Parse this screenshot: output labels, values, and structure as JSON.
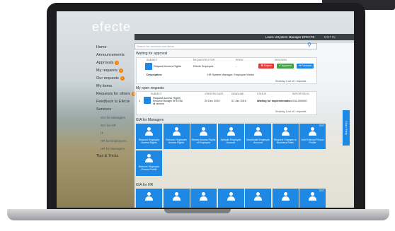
{
  "app": {
    "logo": "efecte"
  },
  "topbar": {
    "user": "Learn: eSystem Manager EFECTE",
    "context": "EXIT IN"
  },
  "nav": {
    "items": [
      {
        "label": "Home",
        "sub": false
      },
      {
        "label": "Announcements",
        "sub": false
      },
      {
        "label": "Approvals",
        "badge": "1",
        "sub": false
      },
      {
        "label": "My requests",
        "badge": "1",
        "sub": false
      },
      {
        "label": "Our requests",
        "badge": "1",
        "sub": false
      },
      {
        "label": "My items",
        "sub": false
      },
      {
        "label": "Requests for others",
        "badge": "1",
        "sub": false
      },
      {
        "label": "Feedback to Efecte",
        "sub": false
      },
      {
        "label": "Services",
        "sub": false
      },
      {
        "label": "IGA for Managers",
        "sub": true
      },
      {
        "label": "IGA for HR",
        "sub": true
      },
      {
        "label": "IT",
        "sub": true
      },
      {
        "label": "HR for Employees",
        "sub": true
      },
      {
        "label": "HR for Managers",
        "sub": true
      },
      {
        "label": "Tips & Tricks",
        "sub": false
      }
    ]
  },
  "search": {
    "placeholder": "Search for services and items..."
  },
  "approvals": {
    "title": "Waiting for approval",
    "headers": [
      "SUBJECT",
      "REQUESTED FOR",
      "PRICE",
      "DECISION"
    ],
    "row": {
      "subject": "Request Access Rights",
      "requested_for": "Efecte Employee",
      "price": "-",
      "description_label": "Description:",
      "description": "HR System Manager: Employee Works"
    },
    "buttons": {
      "reject": "✖ Reject",
      "approve": "✔ Approve",
      "forward": "➜ Forward"
    },
    "showing": "Showing 1 out of 1 requests"
  },
  "open_requests": {
    "title": "My open requests",
    "headers": [
      "SUBJECT",
      "CREATED DATE",
      "DEADLINE",
      "STATUS",
      "REPORTED ID"
    ],
    "row": {
      "num": "1",
      "subject": "Request Access Rights",
      "subject2": "Resource Manager INTEGRA",
      "subject3": "all versions",
      "created": "20 Dec 2019",
      "deadline": "01 Jan 2019",
      "status": "Waiting for implementation",
      "id": "IGA-000000"
    },
    "showing": "Showing 1 out of 1 requests"
  },
  "iga_managers": {
    "title": "IGA for Managers",
    "tiles": [
      {
        "label": "Request Employee Access Rights"
      },
      {
        "label": "Remove Employee Access Rights"
      },
      {
        "label": "Renew Access Rights of Employee"
      },
      {
        "label": "Activate Employee Account"
      },
      {
        "label": "Deactivate Employee Account"
      },
      {
        "label": "Request Changes to Business Roles"
      },
      {
        "label": "Add External Person Profile",
        "ext": "EXT"
      },
      {
        "label": "Remove Employee Person Profile"
      }
    ]
  },
  "iga_hr": {
    "title": "IGA for HR",
    "tiles": [
      {
        "label": ""
      },
      {
        "label": ""
      },
      {
        "label": ""
      },
      {
        "label": ""
      },
      {
        "label": ""
      },
      {
        "label": ""
      },
      {
        "label": "",
        "ext": "EXT"
      }
    ]
  },
  "side_tab": {
    "label": "Chat / Help"
  },
  "colors": {
    "accent": "#1e88e5",
    "reject": "#e53935",
    "approve": "#43a047",
    "forward": "#1e88e5",
    "badge": "#f57c00"
  }
}
